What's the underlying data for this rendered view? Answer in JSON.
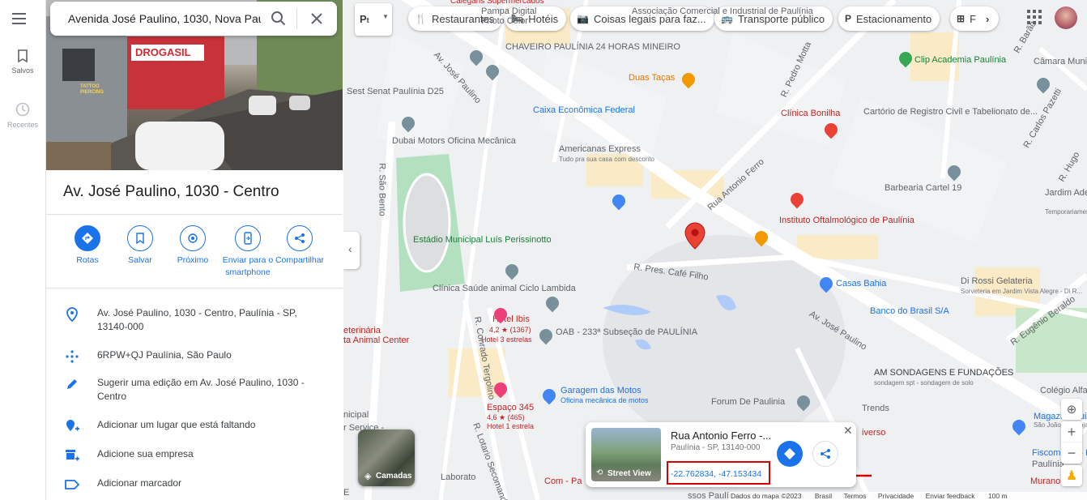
{
  "rail": {
    "saved_label": "Salvos",
    "recent_label": "Recentes"
  },
  "search": {
    "query": "Avenida José Paulino, 1030, Nova Paul"
  },
  "photo": {
    "shop_sign_1": "TATTOO PIERCING",
    "shop_sign_2": "DROGASIL"
  },
  "place": {
    "title": "Av. José Paulino, 1030 - Centro",
    "actions": [
      {
        "label": "Rotas"
      },
      {
        "label": "Salvar"
      },
      {
        "label": "Próximo"
      },
      {
        "label": "Enviar para o smartphone"
      },
      {
        "label": "Compartilhar"
      }
    ],
    "info": [
      {
        "icon": "location-pin-icon",
        "text": "Av. José Paulino, 1030 - Centro, Paulínia - SP, 13140-000"
      },
      {
        "icon": "plus-code-icon",
        "text": "6RPW+QJ Paulínia, São Paulo"
      },
      {
        "icon": "pencil-icon",
        "text": "Sugerir uma edição em Av. José Paulino, 1030 - Centro"
      },
      {
        "icon": "add-place-icon",
        "text": "Adicionar um lugar que está faltando"
      },
      {
        "icon": "add-business-icon",
        "text": "Adicione sua empresa"
      },
      {
        "icon": "label-icon",
        "text": "Adicionar marcador"
      }
    ]
  },
  "map": {
    "chips": [
      {
        "label": "Restaurantes",
        "icon": "fork-knife-icon"
      },
      {
        "label": "Hotéis",
        "icon": "bed-icon"
      },
      {
        "label": "Coisas legais para faz...",
        "icon": "camera-icon"
      },
      {
        "label": "Transporte público",
        "icon": "bus-icon"
      },
      {
        "label": "Estacionamento",
        "icon": "parking-icon"
      },
      {
        "label": "F",
        "icon": "pharmacy-icon"
      }
    ],
    "places": [
      {
        "name": "Calegaris Supermercados",
        "color": "#c5221f"
      },
      {
        "name": "Pampa Digital",
        "color": "#5f6368"
      },
      {
        "name": "Photo Color",
        "color": "#5f6368"
      },
      {
        "name": "Associação Comercial e Industrial de Paulínia",
        "color": "#5f6368"
      },
      {
        "name": "CHAVEIRO PAULÍNIA 24 HORAS MINEIRO",
        "color": "#5f6368"
      },
      {
        "name": "Duas Taças",
        "color": "#e37400"
      },
      {
        "name": "Sest Senat Paulínia D25",
        "color": "#5f6368"
      },
      {
        "name": "Caixa Econômica Federal",
        "color": "#1a73e8"
      },
      {
        "name": "Dubai Motors Oficina Mecânica",
        "color": "#5f6368"
      },
      {
        "name": "Americanas Express",
        "color": "#5f6368"
      },
      {
        "name": "Tudo pra sua casa com desconto",
        "color": "#70757a"
      },
      {
        "name": "Clip Academia Paulínia",
        "color": "#188038"
      },
      {
        "name": "Câmara Municipal",
        "color": "#5f6368"
      },
      {
        "name": "Clínica Bonilha",
        "color": "#c5221f"
      },
      {
        "name": "Cartório de Registro Civil e Tabelionato de...",
        "color": "#5f6368"
      },
      {
        "name": "Barbearia Cartel 19",
        "color": "#5f6368"
      },
      {
        "name": "Jardim Adelmo",
        "color": "#5f6368"
      },
      {
        "name": "Temporariamente",
        "color": "#70757a"
      },
      {
        "name": "Instituto Oftalmológico de Paulínia",
        "color": "#c5221f"
      },
      {
        "name": "Estádio Municipal Luís Perissinotto",
        "color": "#188038"
      },
      {
        "name": "Casas Bahia",
        "color": "#1a73e8"
      },
      {
        "name": "Di Rossi Gelateria",
        "color": "#5f6368"
      },
      {
        "name": "Sorveteria em Jardim Vista Alegre - Di R...",
        "color": "#70757a"
      },
      {
        "name": "Banco do Brasil S/A",
        "color": "#1a73e8"
      },
      {
        "name": "Clínica Saúde animal Ciclo Lambida",
        "color": "#5f6368"
      },
      {
        "name": "Hotel Ibis",
        "color": "#c5221f"
      },
      {
        "name": "4,2 ★ (1367)",
        "color": "#c5221f"
      },
      {
        "name": "Hotel 3 estrelas",
        "color": "#c5221f"
      },
      {
        "name": "OAB - 233ª Subseção de PAULÍNIA",
        "color": "#5f6368"
      },
      {
        "name": "eterinária",
        "color": "#c5221f"
      },
      {
        "name": "ta Animal Center",
        "color": "#c5221f"
      },
      {
        "name": "AM SONDAGENS E FUNDAÇÕES",
        "color": "#3c4043"
      },
      {
        "name": "sondagem spt - sondagem de solo",
        "color": "#70757a"
      },
      {
        "name": "Garagem das Motos",
        "color": "#1a73e8"
      },
      {
        "name": "Oficina mecânica de motos",
        "color": "#1a73e8"
      },
      {
        "name": "Espaço 345",
        "color": "#c5221f"
      },
      {
        "name": "4,6 ★ (465)",
        "color": "#c5221f"
      },
      {
        "name": "Hotel 1 estrela",
        "color": "#c5221f"
      },
      {
        "name": "Forum De Paulinia",
        "color": "#5f6368"
      },
      {
        "name": "Magazine Luiza",
        "color": "#1a73e8"
      },
      {
        "name": "São João Nas Lojas Magalu",
        "color": "#70757a"
      },
      {
        "name": "Colégio Alfa",
        "color": "#5f6368"
      },
      {
        "name": "Fiscomania - Papelaria e Impressão",
        "color": "#1a73e8"
      },
      {
        "name": "Paulínia",
        "color": "#5f6368"
      },
      {
        "name": "Murano",
        "color": "#c5221f"
      },
      {
        "name": "Laborato",
        "color": "#5f6368"
      },
      {
        "name": "Com - Pa",
        "color": "#c5221f"
      },
      {
        "name": "ssos Paulínia",
        "color": "#5f6368"
      },
      {
        "name": "nicipal",
        "color": "#5f6368"
      },
      {
        "name": "r Service -",
        "color": "#5f6368"
      },
      {
        "name": "E",
        "color": "#5f6368"
      },
      {
        "name": "Trends",
        "color": "#5f6368"
      },
      {
        "name": "iverso",
        "color": "#c5221f"
      }
    ],
    "roads": [
      "Av. José Paulino",
      "R. São Bento",
      "R. Pedro Motta",
      "Rua Antonio Ferro",
      "R. Pres. Café Filho",
      "Av. José Paulino",
      "R. Eugênio Beraldo",
      "R. Conrado Tergolino",
      "R. Lotario Secomandi",
      "R. Carlos Pazetti",
      "R. Barão",
      "R. Hugo"
    ],
    "layers_label": "Camadas",
    "streetview_label": "Street View",
    "card": {
      "title": "Rua Antonio Ferro -...",
      "subtitle": "Paulínia - SP, 13140-000",
      "coords": "-22.762834, -47.153434"
    },
    "footer": {
      "data": "Dados do mapa ©2023",
      "country": "Brasil",
      "terms": "Termos",
      "privacy": "Privacidade",
      "feedback": "Enviar feedback",
      "scale": "100 m"
    },
    "pegman": "Pegman"
  },
  "colors": {
    "accent": "#1a73e8",
    "highlight_box": "#d50000",
    "arrow": "#d50000"
  }
}
